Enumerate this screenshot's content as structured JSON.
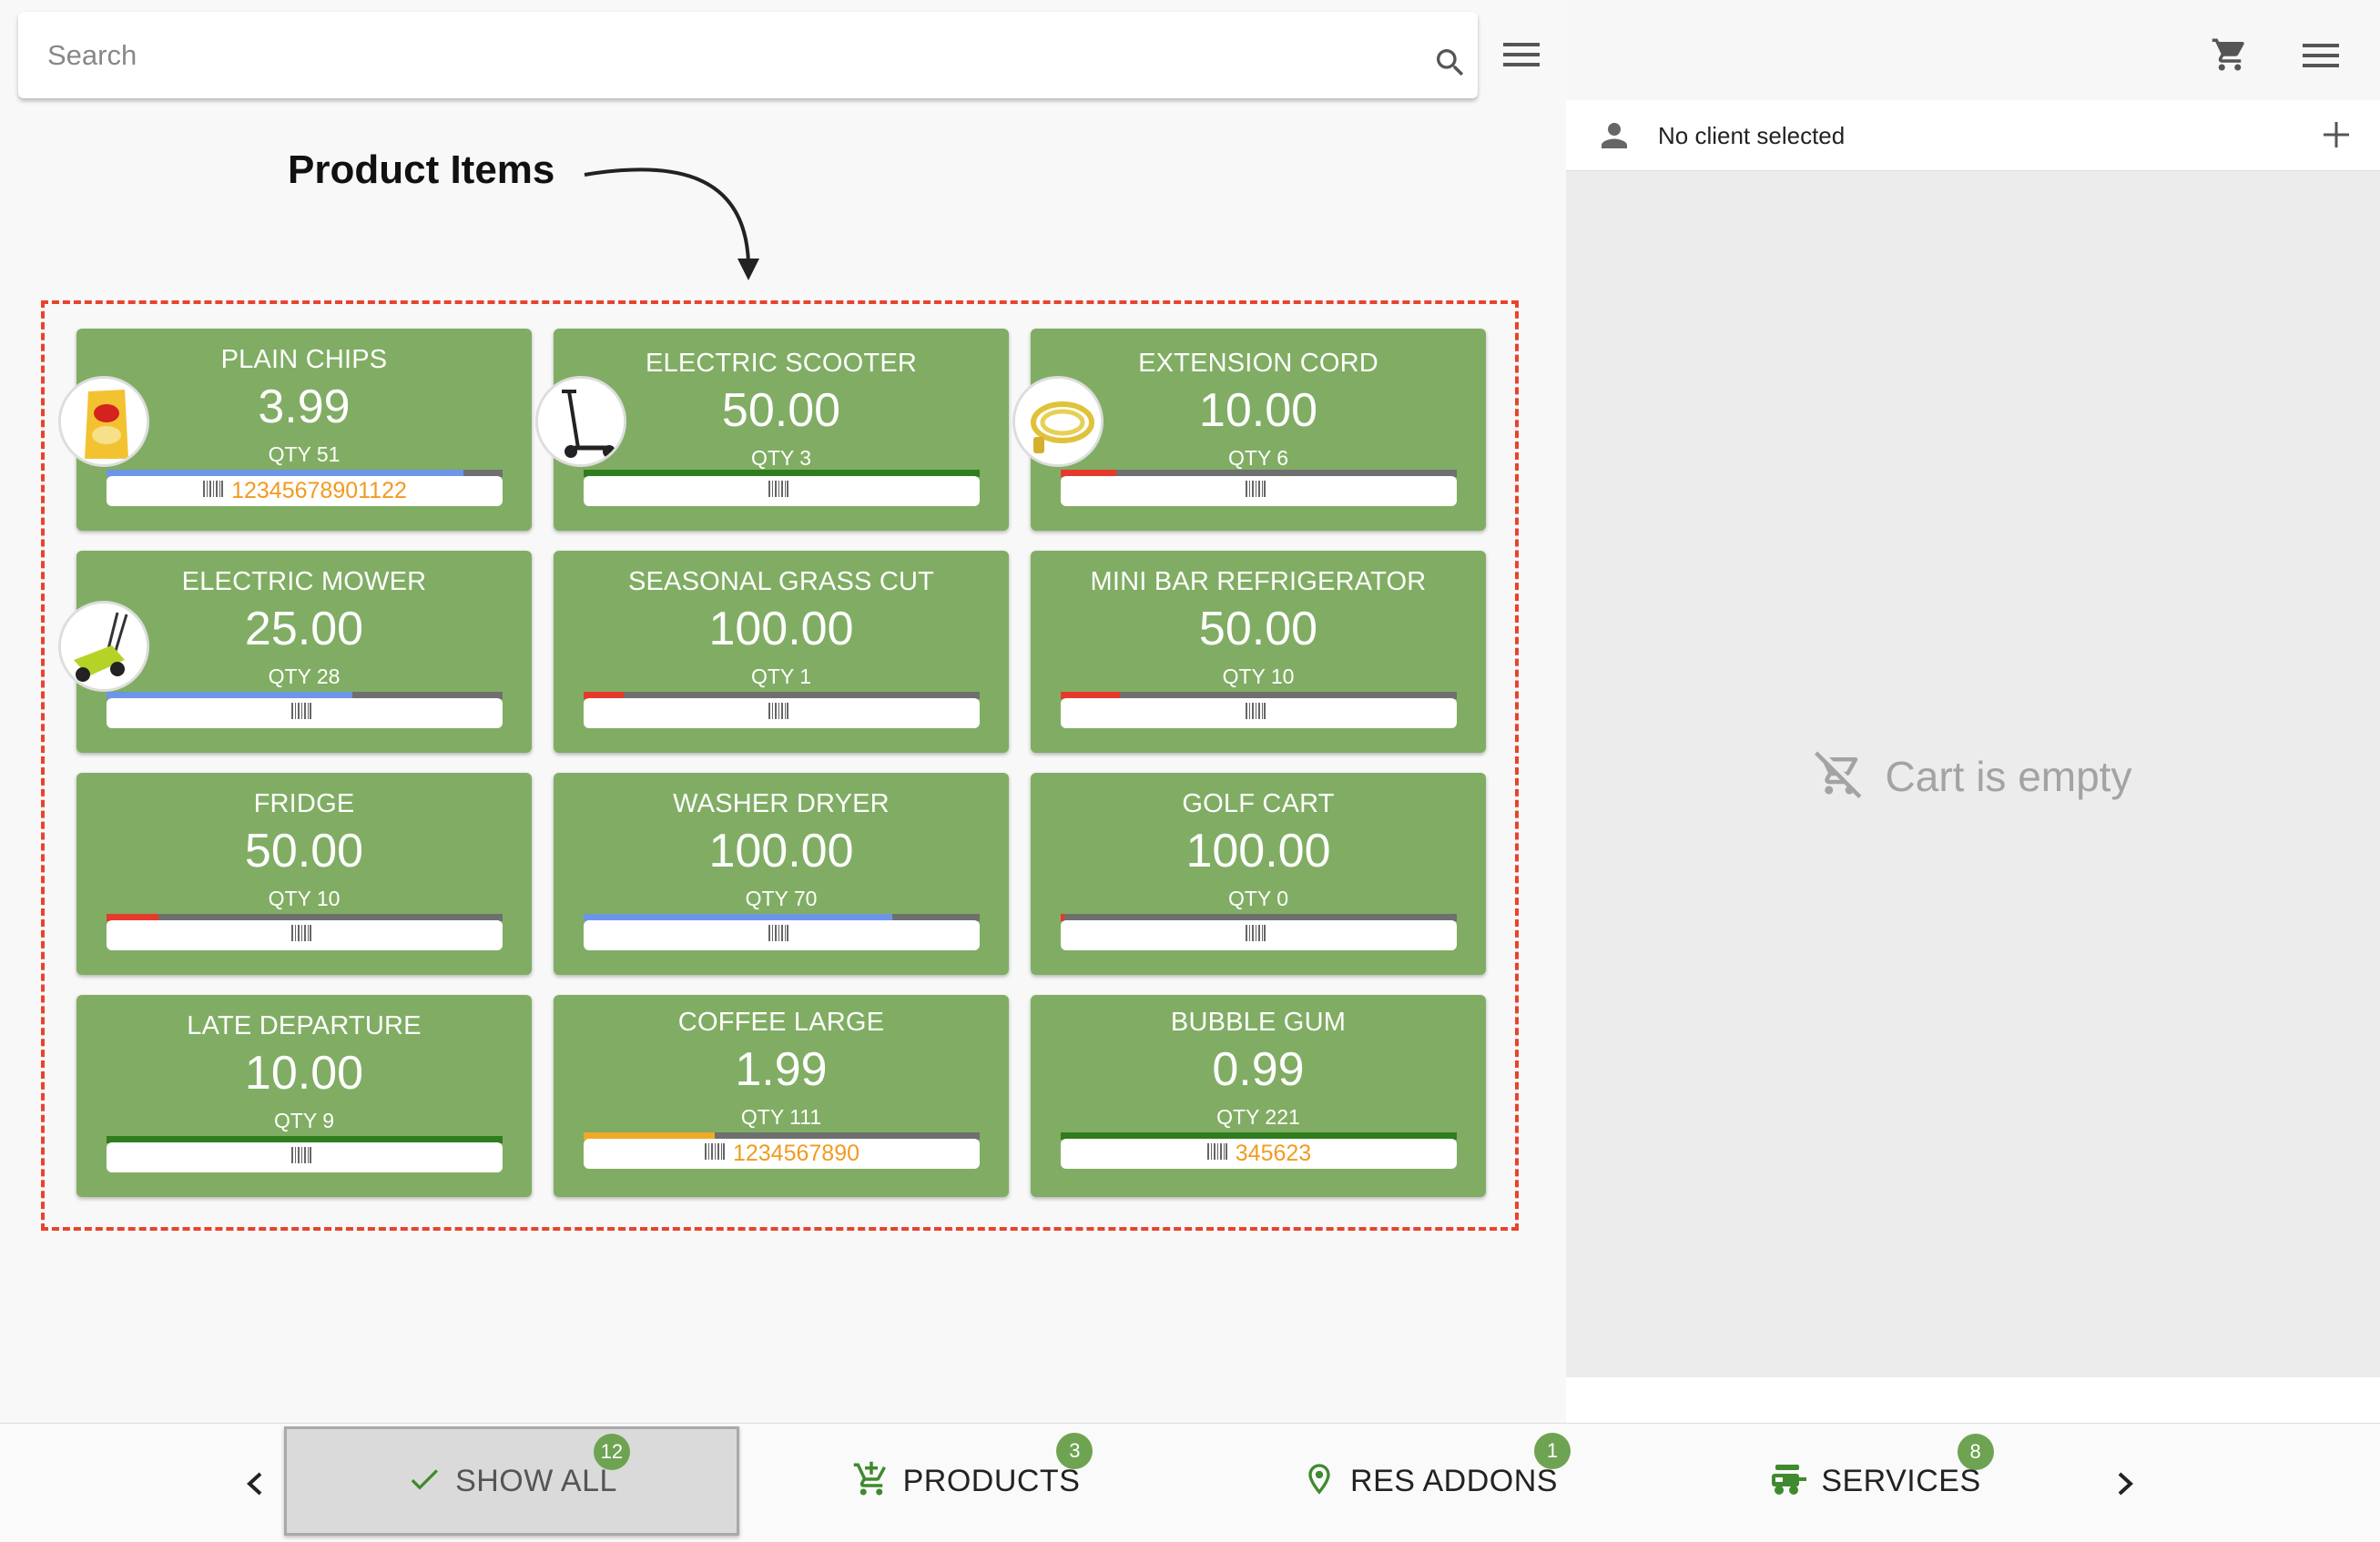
{
  "search": {
    "placeholder": "Search"
  },
  "annotation": {
    "label": "Product Items"
  },
  "products": [
    {
      "name": "PLAIN CHIPS",
      "price": "3.99",
      "qty": "QTY 51",
      "barcode": "12345678901122",
      "stock_fraction": 0.9,
      "stock_color": "#6d95e8",
      "thumb": "chips-bag"
    },
    {
      "name": "ELECTRIC SCOOTER",
      "price": "50.00",
      "qty": "QTY 3",
      "barcode": "",
      "stock_fraction": 1.0,
      "stock_color": "#2f7d1e",
      "thumb": "scooter"
    },
    {
      "name": "EXTENSION CORD",
      "price": "10.00",
      "qty": "QTY 6",
      "barcode": "",
      "stock_fraction": 0.14,
      "stock_color": "#e53a2b",
      "thumb": "cord"
    },
    {
      "name": "ELECTRIC MOWER",
      "price": "25.00",
      "qty": "QTY 28",
      "barcode": "",
      "stock_fraction": 0.62,
      "stock_color": "#6d95e8",
      "thumb": "mower"
    },
    {
      "name": "SEASONAL GRASS CUT",
      "price": "100.00",
      "qty": "QTY 1",
      "barcode": "",
      "stock_fraction": 0.1,
      "stock_color": "#e53a2b",
      "thumb": ""
    },
    {
      "name": "MINI BAR REFRIGERATOR",
      "price": "50.00",
      "qty": "QTY 10",
      "barcode": "",
      "stock_fraction": 0.15,
      "stock_color": "#e53a2b",
      "thumb": ""
    },
    {
      "name": "FRIDGE",
      "price": "50.00",
      "qty": "QTY 10",
      "barcode": "",
      "stock_fraction": 0.13,
      "stock_color": "#e53a2b",
      "thumb": ""
    },
    {
      "name": "WASHER DRYER",
      "price": "100.00",
      "qty": "QTY 70",
      "barcode": "",
      "stock_fraction": 0.78,
      "stock_color": "#6d95e8",
      "thumb": ""
    },
    {
      "name": "GOLF CART",
      "price": "100.00",
      "qty": "QTY 0",
      "barcode": "",
      "stock_fraction": 0.01,
      "stock_color": "#e53a2b",
      "thumb": ""
    },
    {
      "name": "LATE DEPARTURE",
      "price": "10.00",
      "qty": "QTY 9",
      "barcode": "",
      "stock_fraction": 1.0,
      "stock_color": "#2f7d1e",
      "thumb": ""
    },
    {
      "name": "COFFEE LARGE",
      "price": "1.99",
      "qty": "QTY 111",
      "barcode": "1234567890",
      "stock_fraction": 0.33,
      "stock_color": "#f0a928",
      "thumb": ""
    },
    {
      "name": "BUBBLE GUM",
      "price": "0.99",
      "qty": "QTY 221",
      "barcode": "345623",
      "stock_fraction": 1.0,
      "stock_color": "#2f7d1e",
      "thumb": ""
    }
  ],
  "client": {
    "label": "No client selected"
  },
  "cart": {
    "empty_label": "Cart is empty"
  },
  "tabs": [
    {
      "label": "SHOW ALL",
      "badge": "12",
      "icon": "check-icon",
      "active": true
    },
    {
      "label": "PRODUCTS",
      "badge": "3",
      "icon": "cart-add-icon",
      "active": false
    },
    {
      "label": "RES ADDONS",
      "badge": "1",
      "icon": "location-pin-icon",
      "active": false
    },
    {
      "label": "SERVICES",
      "badge": "8",
      "icon": "services-icon",
      "active": false
    }
  ],
  "colors": {
    "card_green": "#80ad63",
    "badge_green": "#6ea352",
    "barcode_text": "#f29a1f",
    "dashed_frame": "#e8432e",
    "stock_track": "#6f6f6f"
  }
}
